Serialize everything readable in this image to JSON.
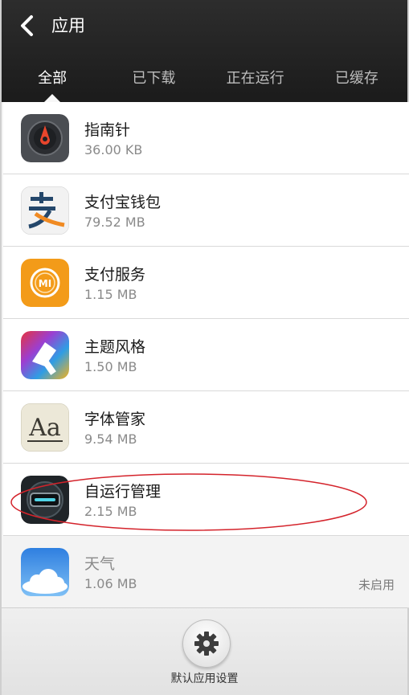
{
  "header": {
    "title": "应用",
    "tabs": [
      "全部",
      "已下载",
      "正在运行",
      "已缓存"
    ],
    "active_tab": 0
  },
  "apps": [
    {
      "name": "指南针",
      "size": "36.00 KB",
      "icon": "compass-icon"
    },
    {
      "name": "支付宝钱包",
      "size": "79.52 MB",
      "icon": "alipay-wallet-icon"
    },
    {
      "name": "支付服务",
      "size": "1.15 MB",
      "icon": "mi-payment-icon"
    },
    {
      "name": "主题风格",
      "size": "1.50 MB",
      "icon": "theme-brush-icon"
    },
    {
      "name": "字体管家",
      "size": "9.54 MB",
      "icon": "font-manager-icon"
    },
    {
      "name": "自运行管理",
      "size": "2.15 MB",
      "icon": "autostart-manager-icon"
    },
    {
      "name": "天气",
      "size": "1.06 MB",
      "icon": "weather-cloud-icon",
      "status": "未启用"
    }
  ],
  "bottom": {
    "settings_label": "默认应用设置",
    "settings_icon": "gear-icon"
  },
  "colors": {
    "header_bg": "#232323",
    "annotation_circle": "#d4232b",
    "compass_bg": "#4a4d52",
    "alipay_orange": "#f08a22",
    "mi_orange": "#f39b19",
    "weather_blue": "#3b8ee6"
  }
}
